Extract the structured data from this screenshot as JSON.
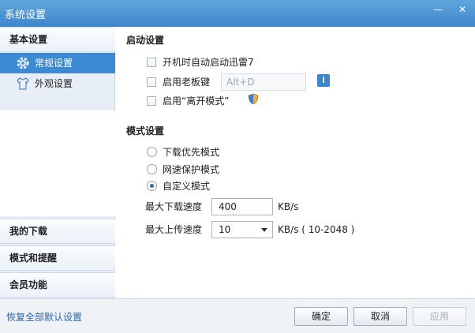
{
  "window": {
    "title": "系统设置"
  },
  "sidebar": {
    "sections": [
      {
        "label": "基本设置"
      },
      {
        "label": "我的下载"
      },
      {
        "label": "模式和提醒"
      },
      {
        "label": "会员功能"
      }
    ],
    "items": [
      {
        "label": "常规设置",
        "icon": "gear-icon"
      },
      {
        "label": "外观设置",
        "icon": "shirt-icon"
      }
    ]
  },
  "startup": {
    "title": "启动设置",
    "autostart_label": "开机时自动启动迅雷7",
    "boss_key_label": "启用老板键",
    "boss_key_value": "Alt+D",
    "away_mode_label": "启用“离开模式”"
  },
  "mode": {
    "title": "模式设置",
    "options": [
      {
        "label": "下载优先模式"
      },
      {
        "label": "网速保护模式"
      },
      {
        "label": "自定义模式"
      }
    ],
    "max_download_label": "最大下载速度",
    "max_download_value": "400",
    "max_download_unit": "KB/s",
    "max_upload_label": "最大上传速度",
    "max_upload_value": "10",
    "max_upload_unit": "KB/s  ( 10-2048 )"
  },
  "footer": {
    "restore_label": "恢复全部默认设置",
    "ok_label": "确定",
    "cancel_label": "取消",
    "apply_label": "应用"
  }
}
